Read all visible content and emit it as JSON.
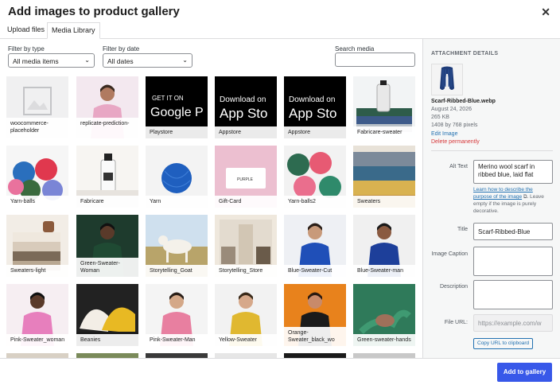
{
  "modal": {
    "title": "Add images to product gallery",
    "close_icon": "close-icon"
  },
  "tabs": [
    {
      "label": "Upload files"
    },
    {
      "label": "Media Library",
      "active": true
    }
  ],
  "filters": {
    "type_label": "Filter by type",
    "type_value": "All media items",
    "date_label": "Filter by date",
    "date_value": "All dates",
    "search_label": "Search media",
    "search_value": ""
  },
  "media": [
    {
      "caption": "woocommerce-placeholder",
      "thumb": "placeholder"
    },
    {
      "caption": "replicate-prediction-",
      "thumb": "person-pink"
    },
    {
      "caption": "Playstore",
      "thumb": "playstore"
    },
    {
      "caption": "Appstore",
      "thumb": "appstore"
    },
    {
      "caption": "Appstore",
      "thumb": "appstore"
    },
    {
      "caption": "Fabricare-sweater",
      "thumb": "fabricare-sweater"
    },
    {
      "caption": "Yarn-balls",
      "thumb": "yarn-balls"
    },
    {
      "caption": "Fabricare",
      "thumb": "fabricare"
    },
    {
      "caption": "Yarn",
      "thumb": "yarn"
    },
    {
      "caption": "Gift-Card",
      "thumb": "gift-card"
    },
    {
      "caption": "Yarn-balls2",
      "thumb": "yarn-balls2"
    },
    {
      "caption": "Sweaters",
      "thumb": "sweaters"
    },
    {
      "caption": "Sweaters-light",
      "thumb": "sweaters-light"
    },
    {
      "caption": "Green-Sweater-Woman",
      "thumb": "green-woman"
    },
    {
      "caption": "Storytelling_Goat",
      "thumb": "goat"
    },
    {
      "caption": "Storytelling_Store",
      "thumb": "store"
    },
    {
      "caption": "Blue-Sweater-Cut",
      "thumb": "blue-cut"
    },
    {
      "caption": "Blue-Sweater-man",
      "thumb": "blue-man"
    },
    {
      "caption": "Pink-Sweater_woman",
      "thumb": "pink-woman"
    },
    {
      "caption": "Beanies",
      "thumb": "beanies"
    },
    {
      "caption": "Pink-Sweater-Man",
      "thumb": "pink-man"
    },
    {
      "caption": "Yellow-Sweater",
      "thumb": "yellow"
    },
    {
      "caption": "Orange-Sweater_black_wo",
      "thumb": "orange"
    },
    {
      "caption": "Green-sweater-hands",
      "thumb": "green-hands"
    }
  ],
  "play_text": {
    "top": "GET IT ON",
    "big": "Google P"
  },
  "app_text": {
    "top": "Download on",
    "big": "App Sto"
  },
  "gift_text": "PURPLE",
  "details": {
    "heading": "ATTACHMENT DETAILS",
    "filename": "Scarf-Ribbed-Blue.webp",
    "date": "August 24, 2026",
    "size": "265 KB",
    "dimensions": "1408 by 768 pixels",
    "edit_link": "Edit Image",
    "delete_link": "Delete permanently",
    "alt_label": "Alt Text",
    "alt_value": "Merino wool scarf in ribbed blue, laid flat",
    "alt_help_link": "Learn how to describe the purpose of the image",
    "alt_help_text": "Leave empty if the image is purely decorative.",
    "title_label": "Title",
    "title_value": "Scarf-Ribbed-Blue",
    "caption_label": "Image Caption",
    "caption_value": "",
    "description_label": "Description",
    "description_value": "",
    "url_label": "File URL:",
    "url_value": "https://example.com/w",
    "copy_button": "Copy URL to clipboard"
  },
  "footer": {
    "add_button": "Add to gallery"
  }
}
